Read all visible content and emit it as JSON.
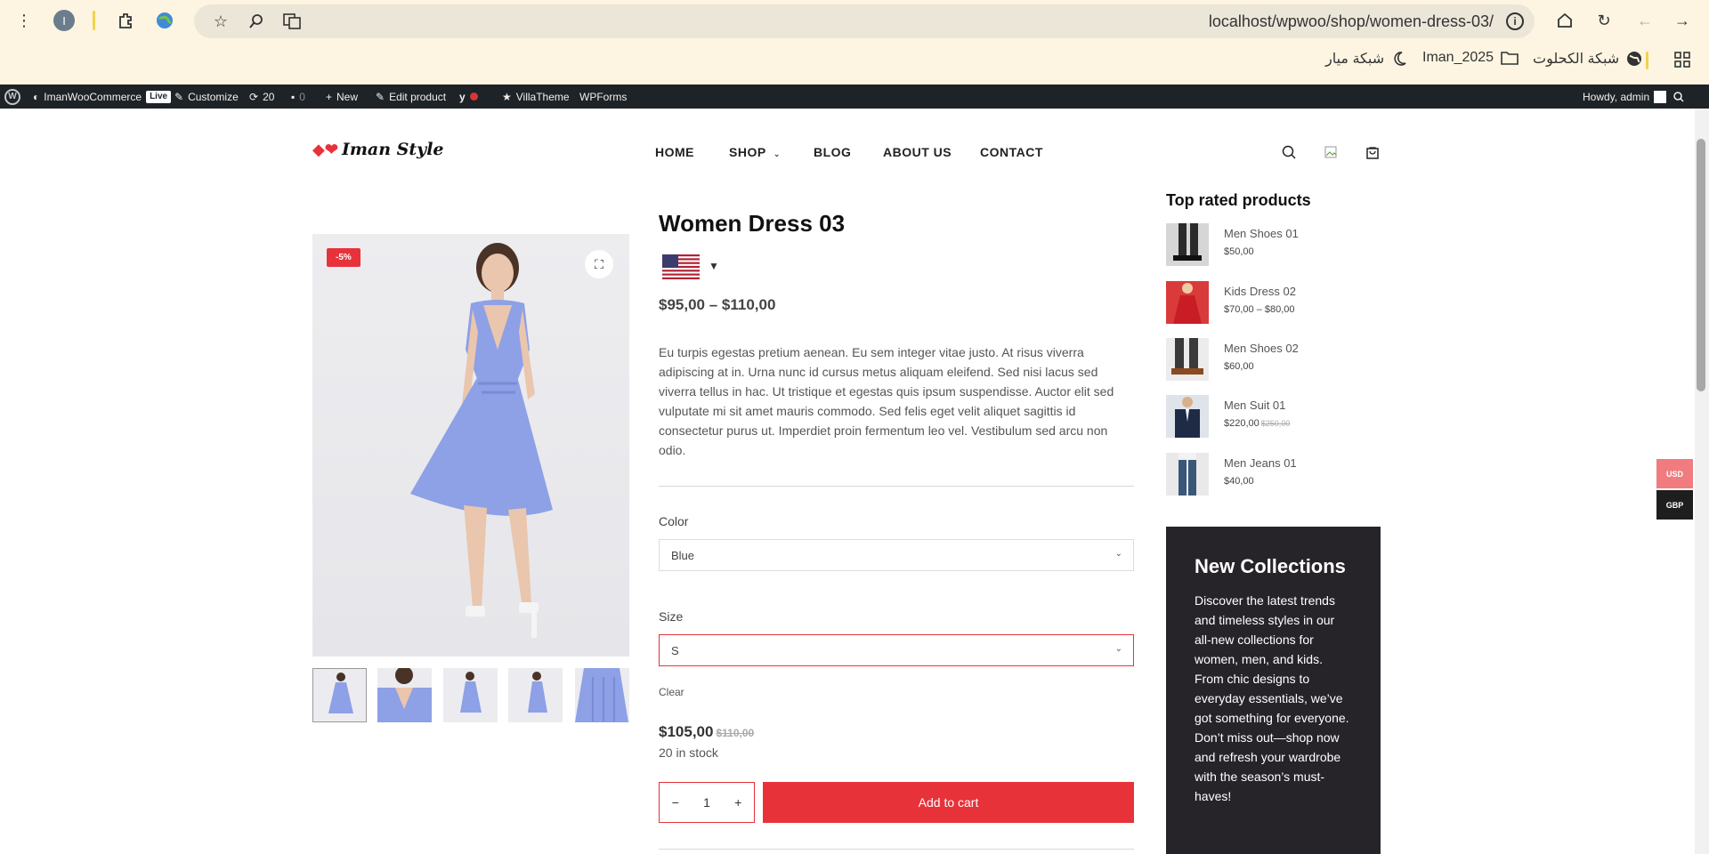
{
  "browser": {
    "url": "localhost/wpwoo/shop/women-dress-03/",
    "profile_initial": "I",
    "bookmarks": [
      {
        "label": "شبكة الكحلوت",
        "icon": "globe-icon"
      },
      {
        "label": "Iman_2025",
        "icon": "folder-icon"
      },
      {
        "label": "شبكة ميار",
        "icon": "moon-icon"
      }
    ]
  },
  "admin_bar": {
    "site_name": "ImanWooCommerce",
    "live_badge": "Live",
    "customize": "Customize",
    "updates": "20",
    "comments": "0",
    "new": "New",
    "edit_product": "Edit product",
    "villatheme": "VillaTheme",
    "wpforms": "WPForms",
    "howdy": "Howdy, admin"
  },
  "site": {
    "logo_text": "Iman Style",
    "nav": [
      "HOME",
      "SHOP",
      "BLOG",
      "ABOUT US",
      "CONTACT"
    ]
  },
  "product": {
    "title": "Women Dress 03",
    "sale_badge": "-5%",
    "price_range": "$95,00 – $110,00",
    "description": "Eu turpis egestas pretium aenean. Eu sem integer vitae justo. At risus viverra adipiscing at in. Urna nunc id cursus metus aliquam eleifend. Sed nisi lacus sed viverra tellus in hac. Ut tristique et egestas quis ipsum suspendisse. Auctor elit sed vulputate mi sit amet mauris commodo. Sed felis eget velit aliquet sagittis id consectetur purus ut. Imperdiet proin fermentum leo vel. Vestibulum sed arcu non odio.",
    "color_label": "Color",
    "color_value": "Blue",
    "size_label": "Size",
    "size_value": "S",
    "clear": "Clear",
    "variation_price": "$105,00",
    "variation_regular_price": "$110,00",
    "stock": "20 in stock",
    "quantity": "1",
    "add_to_cart": "Add to cart",
    "dress_color": "#8ea0e6"
  },
  "sidebar": {
    "top_rated_title": "Top rated products",
    "top_rated": [
      {
        "name": "Men Shoes 01",
        "price": "$50,00",
        "old_price": ""
      },
      {
        "name": "Kids Dress 02",
        "price": "$70,00 – $80,00",
        "old_price": ""
      },
      {
        "name": "Men Shoes 02",
        "price": "$60,00",
        "old_price": ""
      },
      {
        "name": "Men Suit 01",
        "price": "$220,00",
        "old_price": "$250,00"
      },
      {
        "name": "Men Jeans 01",
        "price": "$40,00",
        "old_price": ""
      }
    ],
    "promo_title": "New Collections",
    "promo_text": "Discover the latest trends and timeless styles in our all-new collections for women, men, and kids. From chic designs to everyday essentials, we’ve got something for everyone. Don’t miss out—shop now and refresh your wardrobe with the season’s must-haves!"
  },
  "currency_switcher": [
    "USD",
    "GBP"
  ],
  "colors": {
    "accent": "#e8323a",
    "admin_bar": "#1d2327",
    "promo_bg": "#262429",
    "chrome_bg": "#fdf5e1"
  }
}
